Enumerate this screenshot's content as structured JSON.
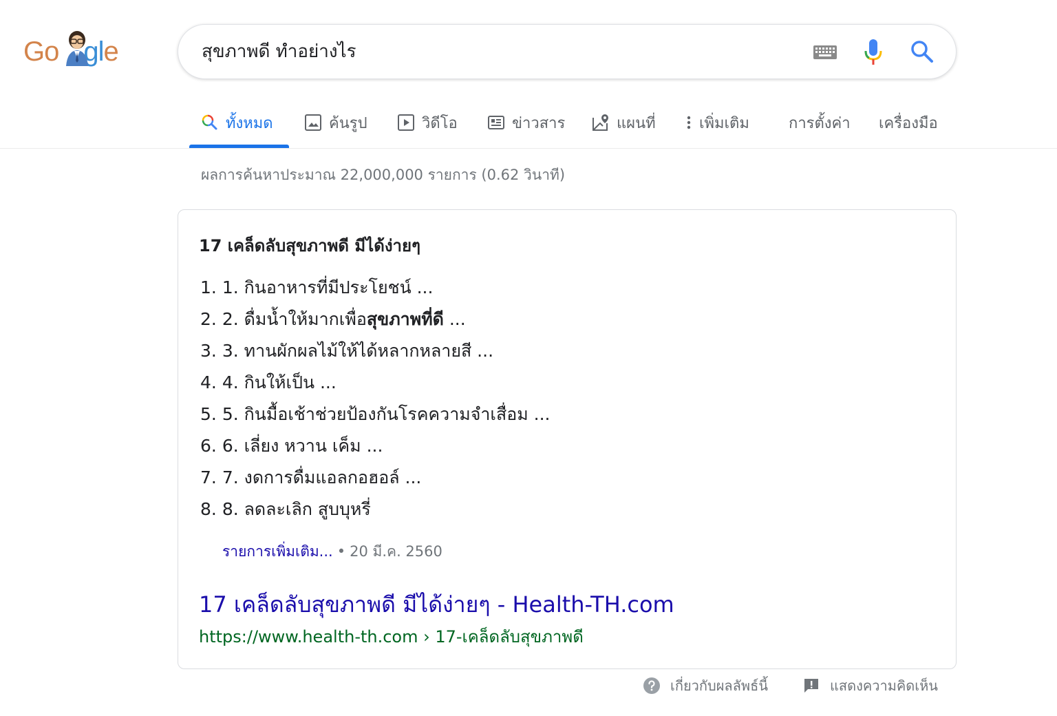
{
  "logo": {
    "letters": [
      "G",
      "o",
      "",
      "g",
      "l",
      "e"
    ],
    "colors": [
      "#d3844b",
      "#d3844b",
      "",
      "#3a8ed6",
      "#3a8ed6",
      "#d3844b"
    ]
  },
  "search": {
    "query": "สุขภาพดี ทำอย่างไร",
    "keyboard_icon": "keyboard-icon",
    "mic_icon": "mic-icon",
    "search_icon": "search-icon"
  },
  "tabs": [
    {
      "label": "ทั้งหมด",
      "icon": "search-icon",
      "active": true
    },
    {
      "label": "ค้นรูป",
      "icon": "image-icon"
    },
    {
      "label": "วิดีโอ",
      "icon": "video-icon"
    },
    {
      "label": "ข่าวสาร",
      "icon": "news-icon"
    },
    {
      "label": "แผนที่",
      "icon": "map-icon"
    },
    {
      "label": "เพิ่มเติม",
      "icon": "more-vert-icon"
    },
    {
      "label": "การตั้งค่า"
    },
    {
      "label": "เครื่องมือ"
    }
  ],
  "stats": "ผลการค้นหาประมาณ 22,000,000 รายการ (0.62 วินาที)",
  "snippet": {
    "heading": "17 เคล็ดลับสุขภาพดี มีได้ง่ายๆ",
    "items": [
      {
        "num": "1.",
        "pre": "1. กินอาหารที่มีประโยชน์ ...",
        "bold": "",
        "post": ""
      },
      {
        "num": "2.",
        "pre": "2. ดื่มน้ำให้มากเพื่อ",
        "bold": "สุขภาพที่ดี",
        "post": " ..."
      },
      {
        "num": "3.",
        "pre": "3. ทานผักผลไม้ให้ได้หลากหลายสี ...",
        "bold": "",
        "post": ""
      },
      {
        "num": "4.",
        "pre": "4. กินให้เป็น ...",
        "bold": "",
        "post": ""
      },
      {
        "num": "5.",
        "pre": "5. กินมื้อเช้าช่วยป้องกันโรคความจำเสื่อม ...",
        "bold": "",
        "post": ""
      },
      {
        "num": "6.",
        "pre": "6. เลี่ยง หวาน เค็ม ...",
        "bold": "",
        "post": ""
      },
      {
        "num": "7.",
        "pre": "7. งดการดื่มแอลกอฮอล์ ...",
        "bold": "",
        "post": ""
      },
      {
        "num": "8.",
        "pre": "8. ลดละเลิก สูบบุหรี่",
        "bold": "",
        "post": ""
      }
    ],
    "more_label": "รายการเพิ่มเติม...",
    "separator": "•",
    "date": "20 มี.ค. 2560",
    "result_title": "17 เคล็ดลับสุขภาพดี มีได้ง่ายๆ - Health-TH.com",
    "result_url": "https://www.health-th.com › 17-เคล็ดลับสุขภาพดี"
  },
  "footer": {
    "about_label": "เกี่ยวกับผลลัพธ์นี้",
    "about_icon": "help-icon",
    "feedback_label": "แสดงความคิดเห็น",
    "feedback_icon": "feedback-icon"
  },
  "colors": {
    "link": "#1a0dab",
    "url": "#006621",
    "accent": "#1a73e8",
    "muted": "#70757a"
  }
}
